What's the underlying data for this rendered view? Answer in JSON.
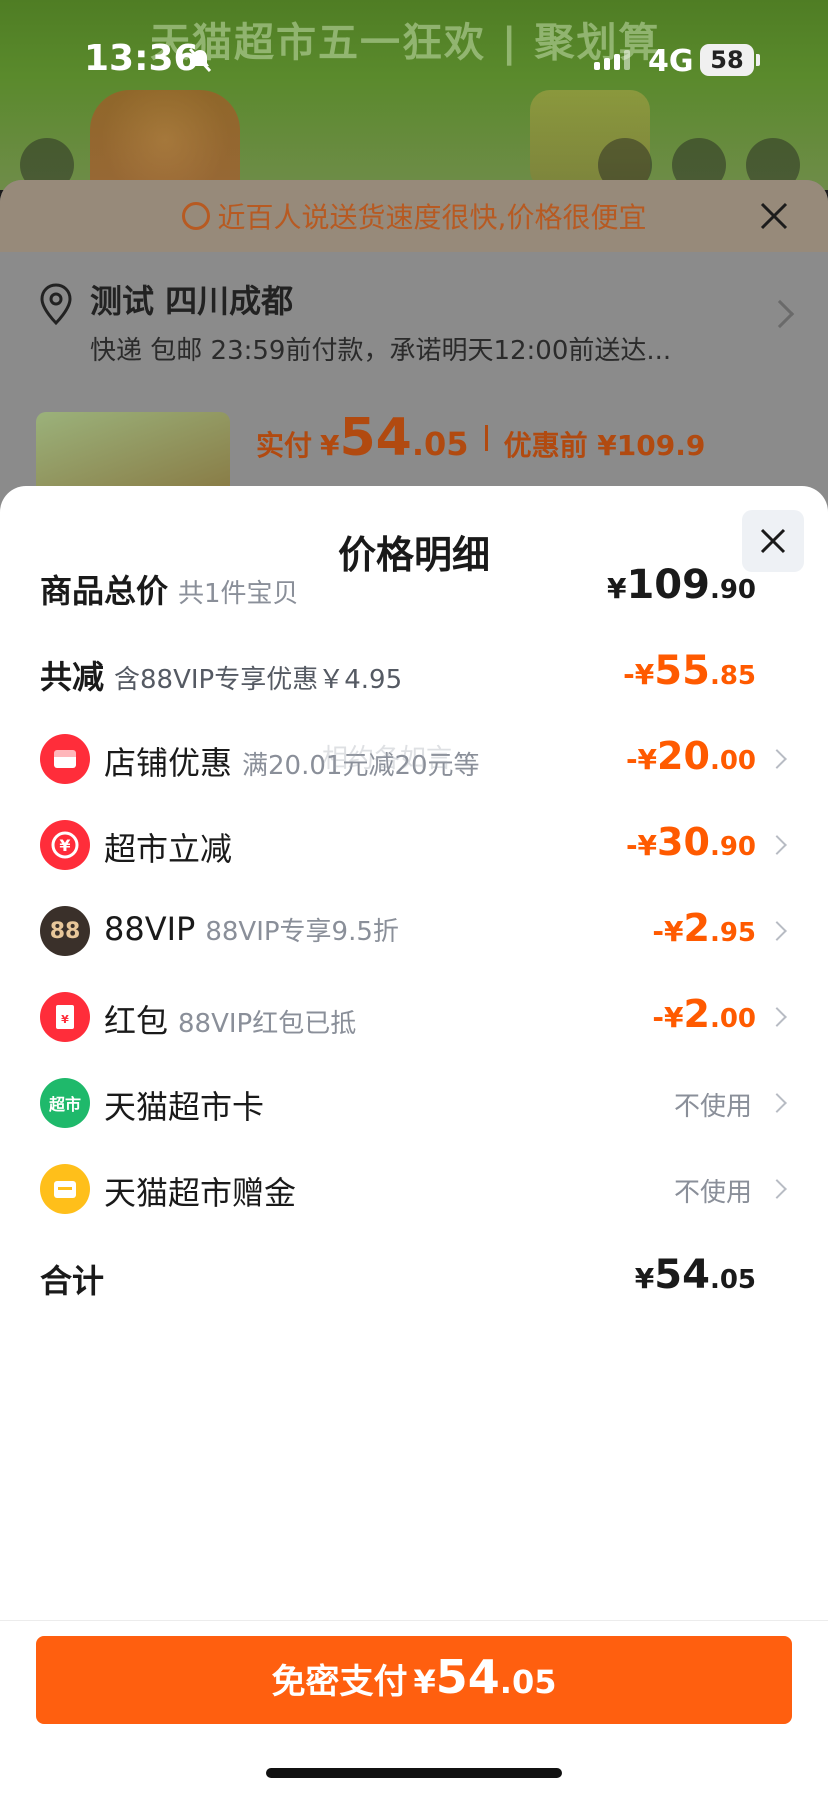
{
  "status_bar": {
    "time": "13:36",
    "network": "4G",
    "battery": "58"
  },
  "background": {
    "banner_text": "天猫超市五一狂欢 | 聚划算",
    "notice": "近百人说送货速度很快,价格很便宜",
    "address_name": "测试 四川成都",
    "address_detail": "快递 包邮 23:59前付款，承诺明天12:00前送达...",
    "price_label": "实付",
    "price_yen": "¥",
    "price_int": "54",
    "price_dec": ".05",
    "orig_price": "优惠前 ¥109.9"
  },
  "sheet": {
    "title": "价格明细",
    "rows": [
      {
        "label": "商品总价",
        "sub": "共1件宝贝",
        "yen": "¥",
        "int": "109",
        "dec": ".90"
      },
      {
        "label": "共减",
        "sub": "含88VIP专享优惠￥4.95",
        "yen": "-¥",
        "int": "55",
        "dec": ".85"
      },
      {
        "label": "店铺优惠",
        "sub": "满20.01元减20元等",
        "yen": "-¥",
        "int": "20",
        "dec": ".00",
        "icon": "shop-icon"
      },
      {
        "label": "超市立减",
        "yen": "-¥",
        "int": "30",
        "dec": ".90",
        "icon": "yen-coin-icon"
      },
      {
        "label": "88VIP",
        "sub": "88VIP专享9.5折",
        "yen": "-¥",
        "int": "2",
        "dec": ".95",
        "icon_text": "88",
        "icon": "vip88-icon"
      },
      {
        "label": "红包",
        "sub": "88VIP红包已抵",
        "yen": "-¥",
        "int": "2",
        "dec": ".00",
        "icon": "red-packet-icon"
      },
      {
        "label": "天猫超市卡",
        "value": "不使用",
        "icon_text": "超市",
        "icon": "supermarket-card-icon"
      },
      {
        "label": "天猫超市赠金",
        "value": "不使用",
        "icon": "gift-money-icon"
      },
      {
        "label": "合计",
        "yen": "¥",
        "int": "54",
        "dec": ".05"
      }
    ],
    "watermark": "相约各如言"
  },
  "pay_button": {
    "label": "免密支付",
    "yen": "¥",
    "int": "54",
    "dec": ".05"
  },
  "colors": {
    "accent": "#ff5f0f",
    "discount": "#ff5a00",
    "muted": "#8a8f99"
  }
}
